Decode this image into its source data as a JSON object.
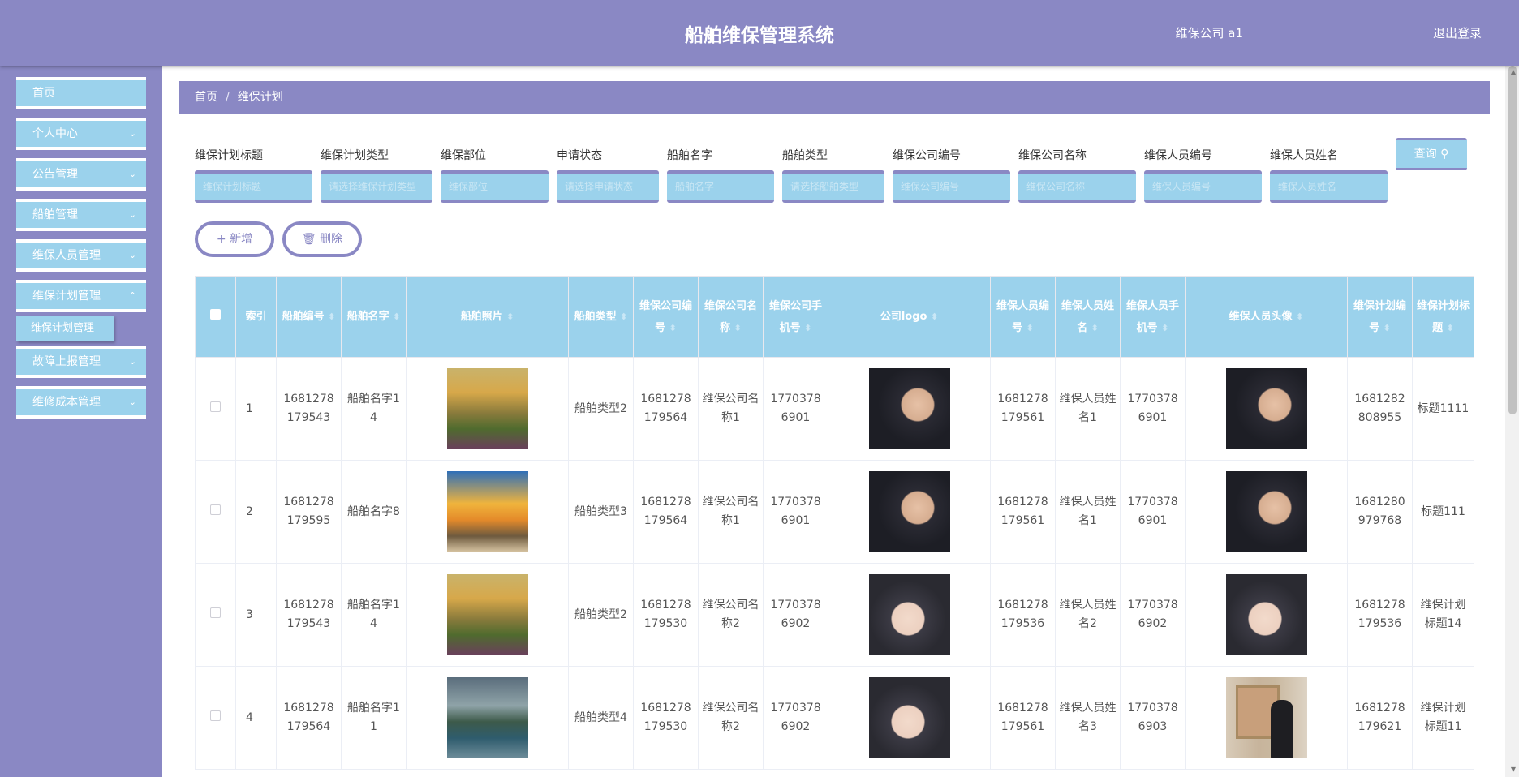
{
  "header": {
    "title": "船舶维保管理系统",
    "user": "维保公司 a1",
    "logout": "退出登录"
  },
  "sidebar": {
    "items": [
      {
        "label": "首页"
      },
      {
        "label": "个人中心"
      },
      {
        "label": "公告管理"
      },
      {
        "label": "船舶管理"
      },
      {
        "label": "维保人员管理"
      },
      {
        "label": "维保计划管理"
      },
      {
        "label": "故障上报管理"
      },
      {
        "label": "维修成本管理"
      }
    ],
    "active_sub": "维保计划管理"
  },
  "breadcrumb": {
    "home": "首页",
    "sep": "/",
    "current": "维保计划"
  },
  "search": {
    "fields": [
      {
        "label": "维保计划标题",
        "placeholder": "维保计划标题"
      },
      {
        "label": "维保计划类型",
        "placeholder": "请选择维保计划类型"
      },
      {
        "label": "维保部位",
        "placeholder": "维保部位"
      },
      {
        "label": "申请状态",
        "placeholder": "请选择申请状态"
      },
      {
        "label": "船舶名字",
        "placeholder": "船舶名字"
      },
      {
        "label": "船舶类型",
        "placeholder": "请选择船舶类型"
      },
      {
        "label": "维保公司编号",
        "placeholder": "维保公司编号"
      },
      {
        "label": "维保公司名称",
        "placeholder": "维保公司名称"
      },
      {
        "label": "维保人员编号",
        "placeholder": "维保人员编号"
      },
      {
        "label": "维保人员姓名",
        "placeholder": "维保人员姓名"
      }
    ],
    "query_button": "查询"
  },
  "actions": {
    "add": "新增",
    "delete": "删除"
  },
  "table": {
    "headers": [
      "索引",
      "船舶编号",
      "船舶名字",
      "船舶照片",
      "船舶类型",
      "维保公司编号",
      "维保公司名称",
      "维保公司手机号",
      "公司logo",
      "维保人员编号",
      "维保人员姓名",
      "维保人员手机号",
      "维保人员头像",
      "维保计划编号",
      "维保计划标题"
    ],
    "sort_glyph": "⬍",
    "rows": [
      {
        "index": "1",
        "ship_no": "1681278179543",
        "ship_name": "船舶名字14",
        "ship_photo": "mountain",
        "ship_type": "船舶类型2",
        "company_no": "1681278179564",
        "company_name": "维保公司名称1",
        "company_phone": "17703786901",
        "logo": "man",
        "staff_no": "1681278179561",
        "staff_name": "维保人员姓名1",
        "staff_phone": "17703786901",
        "avatar": "man",
        "plan_no": "1681282808955",
        "plan_title": "标题1111"
      },
      {
        "index": "2",
        "ship_no": "1681278179595",
        "ship_name": "船舶名字8",
        "ship_photo": "sunset",
        "ship_type": "船舶类型3",
        "company_no": "1681278179564",
        "company_name": "维保公司名称1",
        "company_phone": "17703786901",
        "logo": "man",
        "staff_no": "1681278179561",
        "staff_name": "维保人员姓名1",
        "staff_phone": "17703786901",
        "avatar": "man",
        "plan_no": "1681280979768",
        "plan_title": "标题111"
      },
      {
        "index": "3",
        "ship_no": "1681278179543",
        "ship_name": "船舶名字14",
        "ship_photo": "mountain",
        "ship_type": "船舶类型2",
        "company_no": "1681278179530",
        "company_name": "维保公司名称2",
        "company_phone": "17703786902",
        "logo": "woman",
        "staff_no": "1681278179536",
        "staff_name": "维保人员姓名2",
        "staff_phone": "17703786902",
        "avatar": "woman",
        "plan_no": "1681278179536",
        "plan_title": "维保计划标题14"
      },
      {
        "index": "4",
        "ship_no": "1681278179564",
        "ship_name": "船舶名字11",
        "ship_photo": "lake",
        "ship_type": "船舶类型4",
        "company_no": "1681278179530",
        "company_name": "维保公司名称2",
        "company_phone": "17703786902",
        "logo": "woman",
        "staff_no": "1681278179561",
        "staff_name": "维保人员姓名3",
        "staff_phone": "17703786903",
        "avatar": "painting",
        "plan_no": "1681278179621",
        "plan_title": "维保计划标题11"
      }
    ]
  }
}
